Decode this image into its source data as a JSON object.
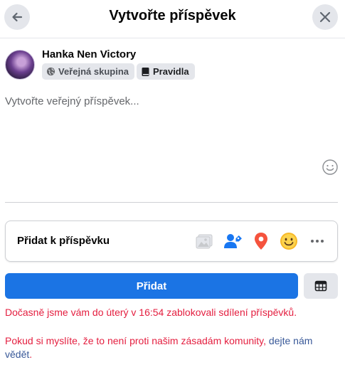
{
  "header": {
    "title": "Vytvořte příspěvek",
    "back_icon": "arrow-left-icon",
    "close_icon": "close-icon"
  },
  "author": {
    "name": "Hanka Nen Victory",
    "audience_chip": "Veřejná skupina",
    "rules_chip": "Pravidla"
  },
  "composer": {
    "placeholder": "Vytvořte veřejný příspěvek..."
  },
  "add_to_post": {
    "label": "Přidat k příspěvku",
    "icons": [
      "photo-icon",
      "tag-people-icon",
      "location-pin-icon",
      "feeling-emoji-icon",
      "more-icon"
    ]
  },
  "actions": {
    "post_label": "Přidat",
    "table_icon": "table-icon"
  },
  "messages": {
    "blocked": "Dočasně jsme vám do úterý v 16:54 zablokovali sdílení příspěvků.",
    "notice_prefix": "Pokud si myslíte, že to není proti našim zásadám komunity, ",
    "notice_link": "dejte nám vědět",
    "notice_suffix": "."
  },
  "colors": {
    "primary": "#1b74e4",
    "error": "#e41e3f",
    "link": "#385898"
  }
}
